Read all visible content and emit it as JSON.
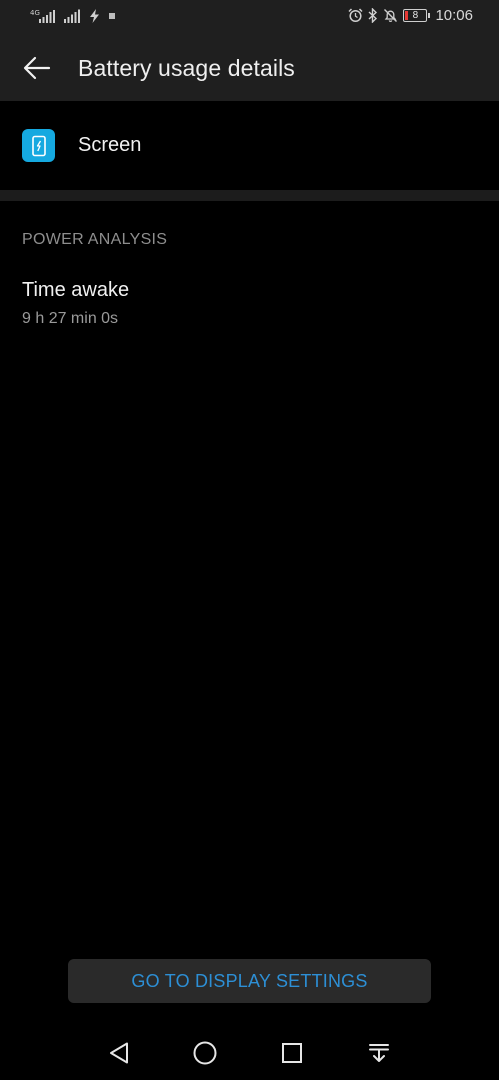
{
  "status_bar": {
    "time": "10:06",
    "network_label": "4G",
    "battery_level": "8",
    "icons": [
      "signal-4g-icon",
      "signal-icon",
      "charging-icon",
      "notification-icon",
      "alarm-icon",
      "bluetooth-icon",
      "silent-icon",
      "battery-icon"
    ],
    "battery_color": "#e53935"
  },
  "app_bar": {
    "title": "Battery usage details",
    "back_icon": "back-arrow-icon"
  },
  "app_entry": {
    "label": "Screen",
    "icon": "screen-app-icon",
    "icon_color": "#15a9e0"
  },
  "power_analysis": {
    "header": "POWER ANALYSIS",
    "time_awake_label": "Time awake",
    "time_awake_value": "9 h 27 min 0s"
  },
  "action": {
    "label": "GO TO DISPLAY SETTINGS",
    "color": "#2d8fd5"
  },
  "nav_bar": {
    "icons": [
      "back-icon",
      "home-icon",
      "recents-icon",
      "notifications-pull-icon"
    ]
  }
}
